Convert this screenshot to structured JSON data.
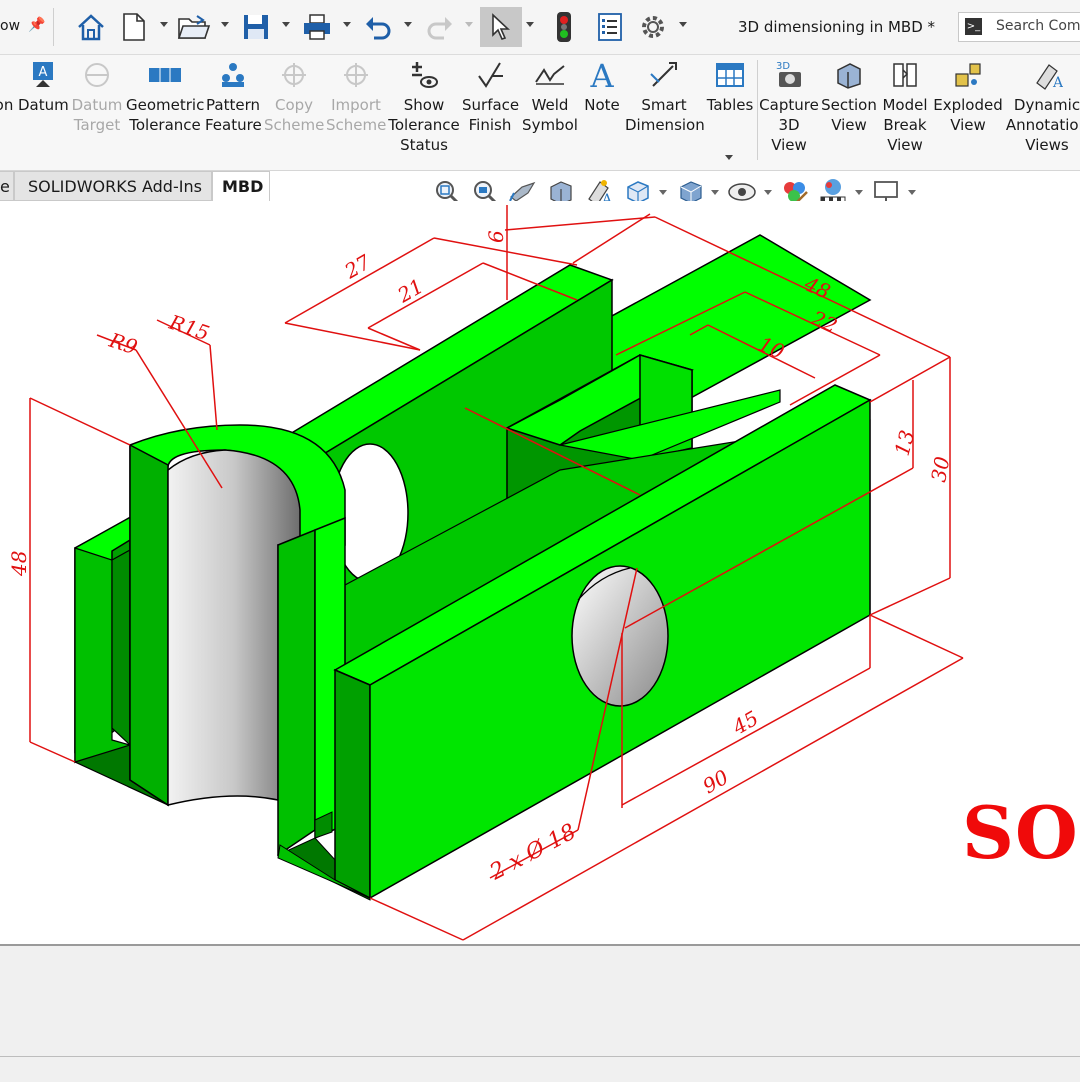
{
  "titlebar": {
    "left_fragment": "ow",
    "document_title": "3D dimensioning in MBD *",
    "search_placeholder": "Search Comm"
  },
  "toolbar_icons": [
    "home-icon",
    "new-document-icon",
    "open-folder-icon",
    "save-icon",
    "print-icon",
    "undo-icon",
    "redo-icon",
    "select-pointer-icon",
    "rebuild-traffic-light-icon",
    "file-properties-icon",
    "options-gear-icon"
  ],
  "ribbon": {
    "items": [
      {
        "label": "on",
        "enabled": true
      },
      {
        "label": "Datum",
        "enabled": true
      },
      {
        "label": "Datum\nTarget",
        "enabled": false
      },
      {
        "label": "Geometric\nTolerance",
        "enabled": true
      },
      {
        "label": "Pattern\nFeature",
        "enabled": true
      },
      {
        "label": "Copy\nScheme",
        "enabled": false
      },
      {
        "label": "Import\nScheme",
        "enabled": false
      },
      {
        "label": "Show\nTolerance\nStatus",
        "enabled": true
      },
      {
        "label": "Surface\nFinish",
        "enabled": true
      },
      {
        "label": "Weld\nSymbol",
        "enabled": true
      },
      {
        "label": "Note",
        "enabled": true
      },
      {
        "label": "Smart\nDimension",
        "enabled": true
      },
      {
        "label": "Tables",
        "enabled": true
      },
      {
        "label": "Capture\n3D\nView",
        "enabled": true
      },
      {
        "label": "Section\nView",
        "enabled": true
      },
      {
        "label": "Model\nBreak\nView",
        "enabled": true
      },
      {
        "label": "Exploded\nView",
        "enabled": true
      },
      {
        "label": "Dynamic\nAnnotation\nViews",
        "enabled": true
      }
    ]
  },
  "tabs": [
    {
      "label": "e",
      "active": false
    },
    {
      "label": "SOLIDWORKS Add-Ins",
      "active": false
    },
    {
      "label": "MBD",
      "active": true
    }
  ],
  "heads_up_icons": [
    "zoom-to-fit-icon",
    "zoom-to-area-icon",
    "previous-view-icon",
    "section-view-icon",
    "dynamic-annotation-icon",
    "view-orientation-icon",
    "display-style-icon",
    "hide-show-items-icon",
    "edit-appearance-icon",
    "apply-scene-icon",
    "view-settings-icon"
  ],
  "dimensions": {
    "d6": "6",
    "d27": "27",
    "d21": "21",
    "r9": "R9",
    "r15": "R15",
    "d48_top": "48",
    "d22": "22",
    "d10": "10",
    "d13": "13",
    "d30": "30",
    "d48_left": "48",
    "d45": "45",
    "d90": "90",
    "hole": "2 x Ø 18"
  },
  "watermark": "SOL",
  "colors": {
    "model_face": "#00ff00",
    "model_side": "#00c800",
    "model_dark": "#008c00",
    "dimension": "#e01010"
  }
}
